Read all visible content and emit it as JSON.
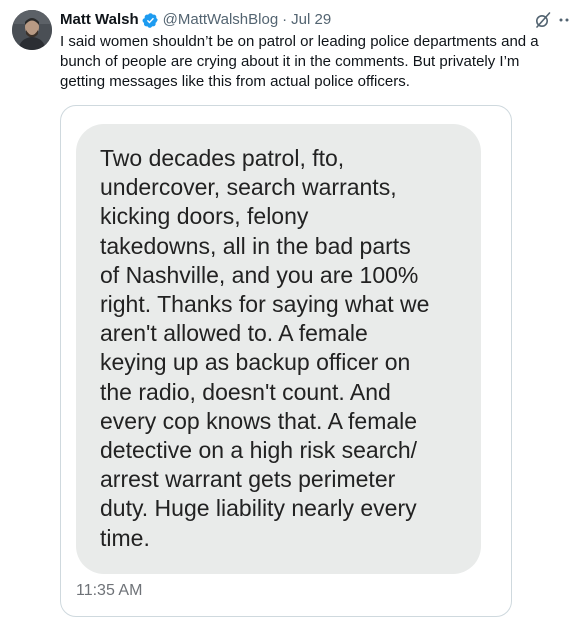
{
  "author": {
    "name": "Matt Walsh",
    "handle": "@MattWalshBlog",
    "separator": "·",
    "date": "Jul 29",
    "verified_color": "#1d9bf0"
  },
  "tweet": {
    "text": "I said women shouldn’t be on patrol or leading police departments and a\nbunch of people are crying about it in the comments. But privately I’m\ngetting messages like this from actual police officers."
  },
  "icons": {
    "grok": "grok-icon",
    "more": "more-icon",
    "verified": "verified-badge-icon"
  },
  "media": {
    "message_lines": [
      "Two decades patrol, fto,",
      "undercover, search warrants,",
      "kicking doors, felony",
      "takedowns, all in the bad parts",
      "of Nashville, and you are 100%",
      "right. Thanks for saying what we",
      "aren't allowed to. A female",
      "keying up as backup officer on",
      "the radio, doesn't count. And",
      "every cop knows that. A female",
      "detective on a high risk search/",
      "arrest warrant gets perimeter",
      "duty. Huge liability nearly every",
      "time."
    ],
    "timestamp": "11:35 AM"
  }
}
